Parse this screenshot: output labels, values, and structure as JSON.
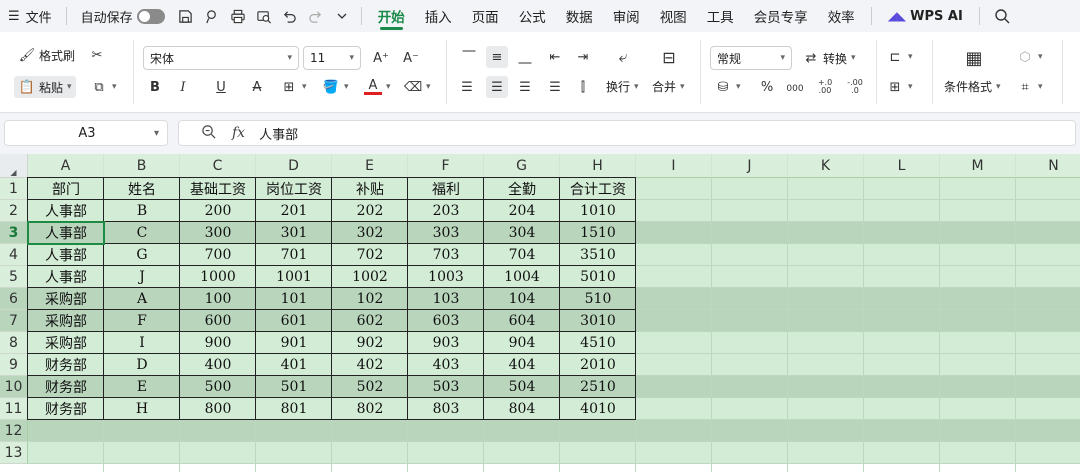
{
  "menu": {
    "hamburger": "☰",
    "file": "文件",
    "autosave": "自动保存",
    "tabs": [
      "开始",
      "插入",
      "页面",
      "公式",
      "数据",
      "审阅",
      "视图",
      "工具",
      "会员专享",
      "效率"
    ],
    "active_tab": "开始",
    "wps_ai": "WPS AI"
  },
  "ribbon": {
    "format_painter": "格式刷",
    "paste": "粘贴",
    "font_name": "宋体",
    "font_size": "11",
    "wrap": "换行",
    "merge": "合并",
    "number_format": "常规",
    "convert": "转换",
    "conditional_format": "条件格式",
    "percent": "%",
    "thousands": "000",
    "inc_decimal": "+.0 .00",
    "dec_decimal": "-.00 .0",
    "bold": "B",
    "italic": "I",
    "underline": "U",
    "strike": "A"
  },
  "formula_bar": {
    "name_box": "A3",
    "fx": "fx",
    "content": "人事部"
  },
  "sheet": {
    "columns": [
      "A",
      "B",
      "C",
      "D",
      "E",
      "F",
      "G",
      "H",
      "I",
      "J",
      "K",
      "L",
      "M",
      "N"
    ],
    "rows": [
      "1",
      "2",
      "3",
      "4",
      "5",
      "6",
      "7",
      "8",
      "9",
      "10",
      "11",
      "12",
      "13"
    ],
    "header": [
      "部门",
      "姓名",
      "基础工资",
      "岗位工资",
      "补贴",
      "福利",
      "全勤",
      "合计工资"
    ],
    "data": [
      [
        "人事部",
        "B",
        "200",
        "201",
        "202",
        "203",
        "204",
        "1010"
      ],
      [
        "人事部",
        "C",
        "300",
        "301",
        "302",
        "303",
        "304",
        "1510"
      ],
      [
        "人事部",
        "G",
        "700",
        "701",
        "702",
        "703",
        "704",
        "3510"
      ],
      [
        "人事部",
        "J",
        "1000",
        "1001",
        "1002",
        "1003",
        "1004",
        "5010"
      ],
      [
        "采购部",
        "A",
        "100",
        "101",
        "102",
        "103",
        "104",
        "510"
      ],
      [
        "采购部",
        "F",
        "600",
        "601",
        "602",
        "603",
        "604",
        "3010"
      ],
      [
        "采购部",
        "I",
        "900",
        "901",
        "902",
        "903",
        "904",
        "4510"
      ],
      [
        "财务部",
        "D",
        "400",
        "401",
        "402",
        "403",
        "404",
        "2010"
      ],
      [
        "财务部",
        "E",
        "500",
        "501",
        "502",
        "503",
        "504",
        "2510"
      ],
      [
        "财务部",
        "H",
        "800",
        "801",
        "802",
        "803",
        "804",
        "4010"
      ]
    ],
    "selected_cell": "A3",
    "dark_rows": [
      "3",
      "6",
      "7",
      "10",
      "12"
    ]
  },
  "colors": {
    "accent": "#1a8a4a",
    "row_light": "#d3ecd5",
    "row_dark": "#b9d6bd"
  }
}
